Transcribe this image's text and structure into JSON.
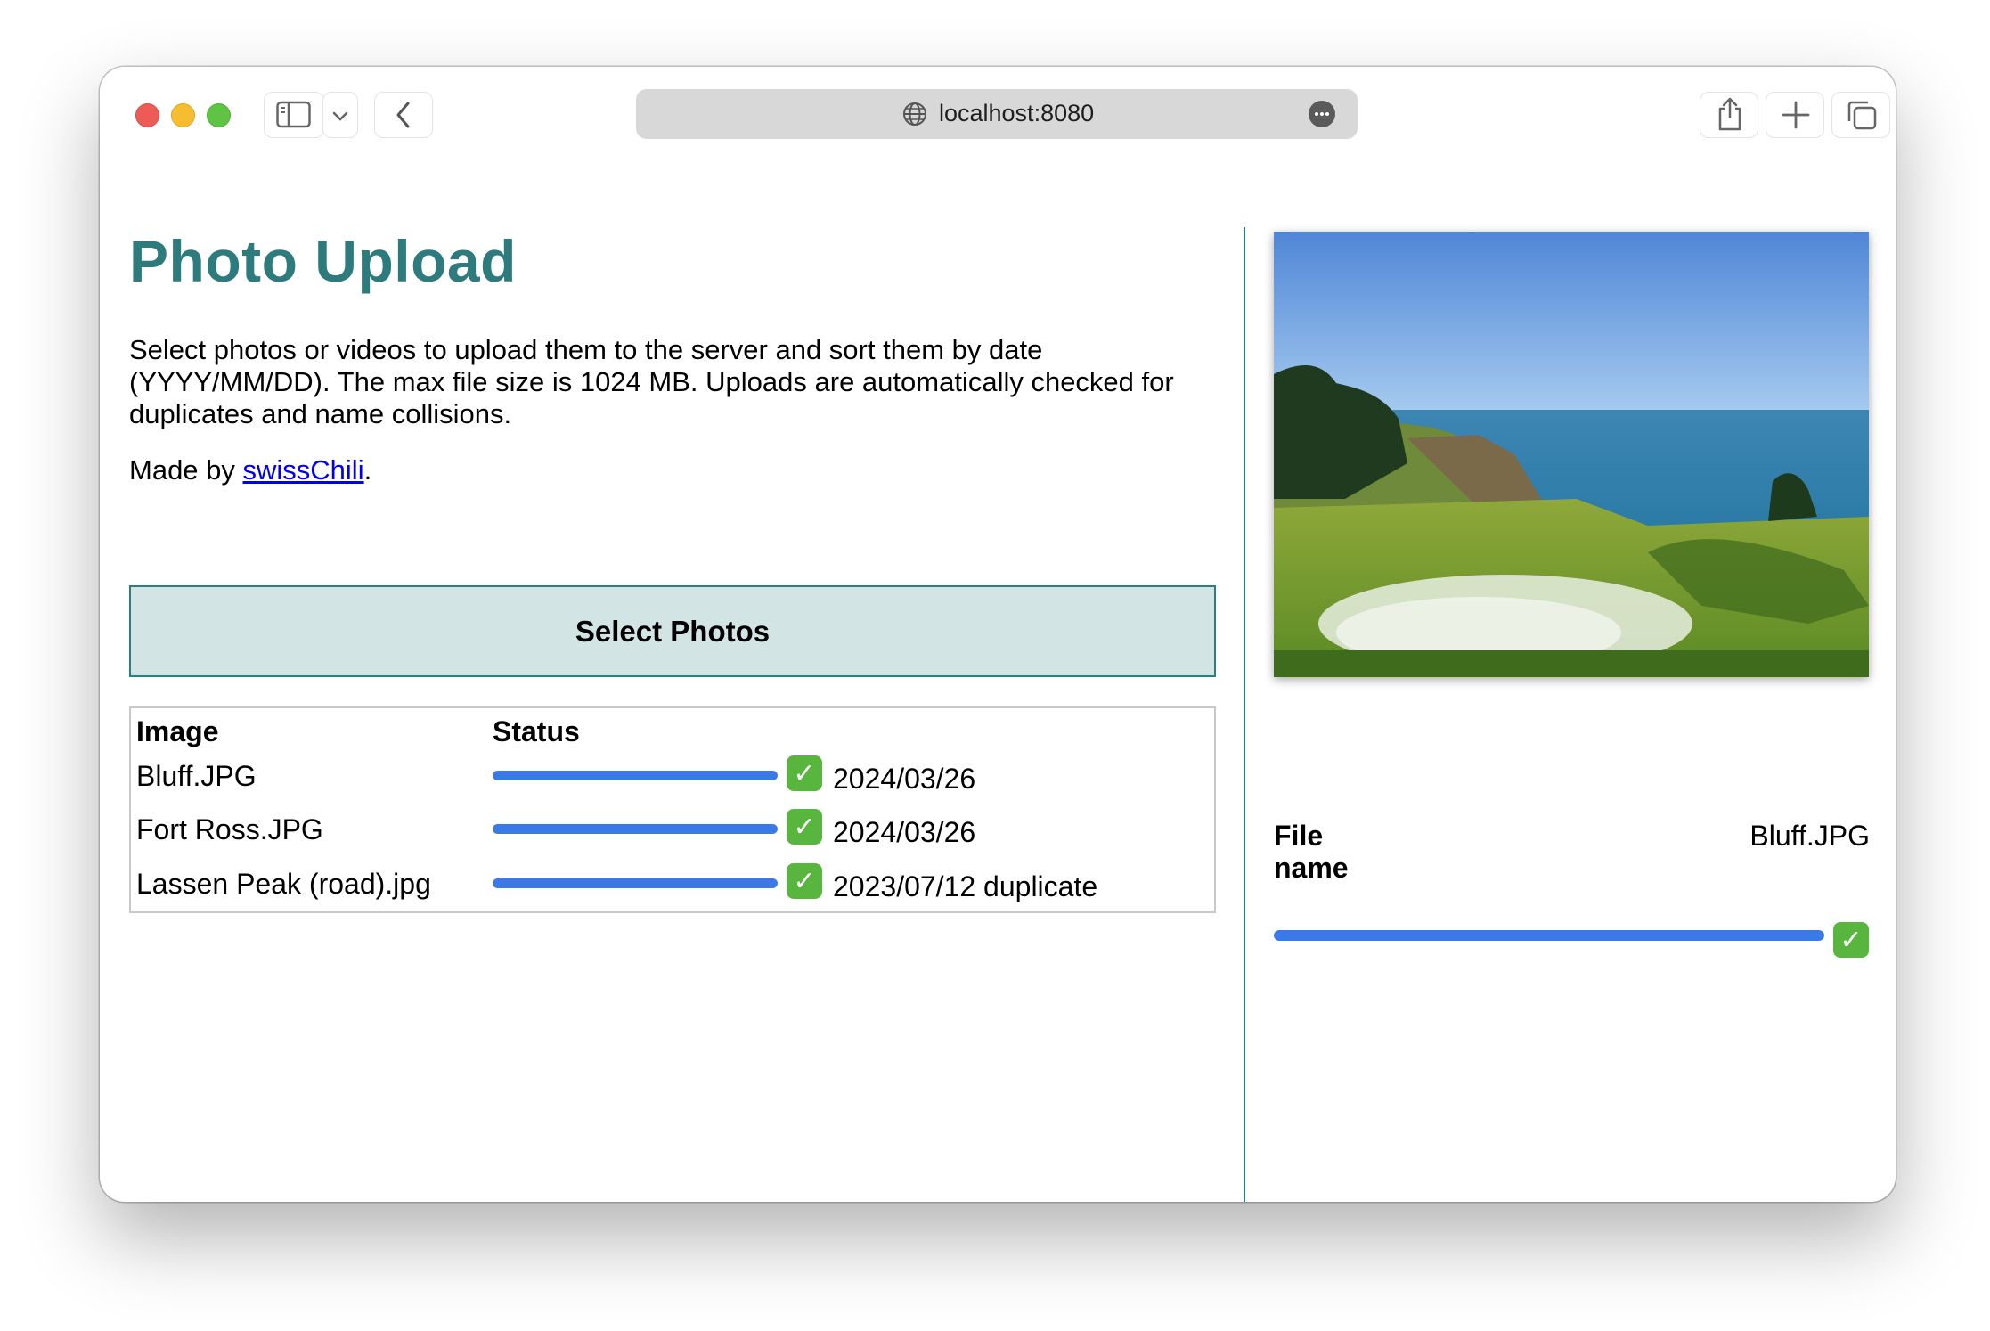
{
  "browser": {
    "url": "localhost:8080"
  },
  "page": {
    "title": "Photo Upload",
    "description": "Select photos or videos to upload them to the server and sort them by date (YYYY/MM/DD). The max file size is 1024 MB. Uploads are automatically checked for duplicates and name collisions.",
    "made_by_prefix": "Made by ",
    "made_by_link": "swissChili",
    "made_by_suffix": ".",
    "select_button": "Select Photos"
  },
  "table": {
    "headers": [
      "Image",
      "Status"
    ],
    "rows": [
      {
        "name": "Bluff.JPG",
        "progress": 1.0,
        "status_icon": "check-mark-icon",
        "result": "2024/03/26"
      },
      {
        "name": "Fort Ross.JPG",
        "progress": 1.0,
        "status_icon": "check-mark-icon",
        "result": "2024/03/26"
      },
      {
        "name": "Lassen Peak (road).jpg",
        "progress": 1.0,
        "status_icon": "check-mark-icon",
        "result": "2023/07/12 duplicate"
      }
    ]
  },
  "preview": {
    "file_name_label": "File name",
    "file_name_value": "Bluff.JPG",
    "progress": 1.0,
    "status_icon": "check-mark-icon"
  },
  "colors": {
    "accent": "#2e7b7e",
    "button_bg": "#d2e4e3",
    "progress": "#3b7ae6",
    "check": "#58b53d",
    "link": "#0000ee"
  }
}
